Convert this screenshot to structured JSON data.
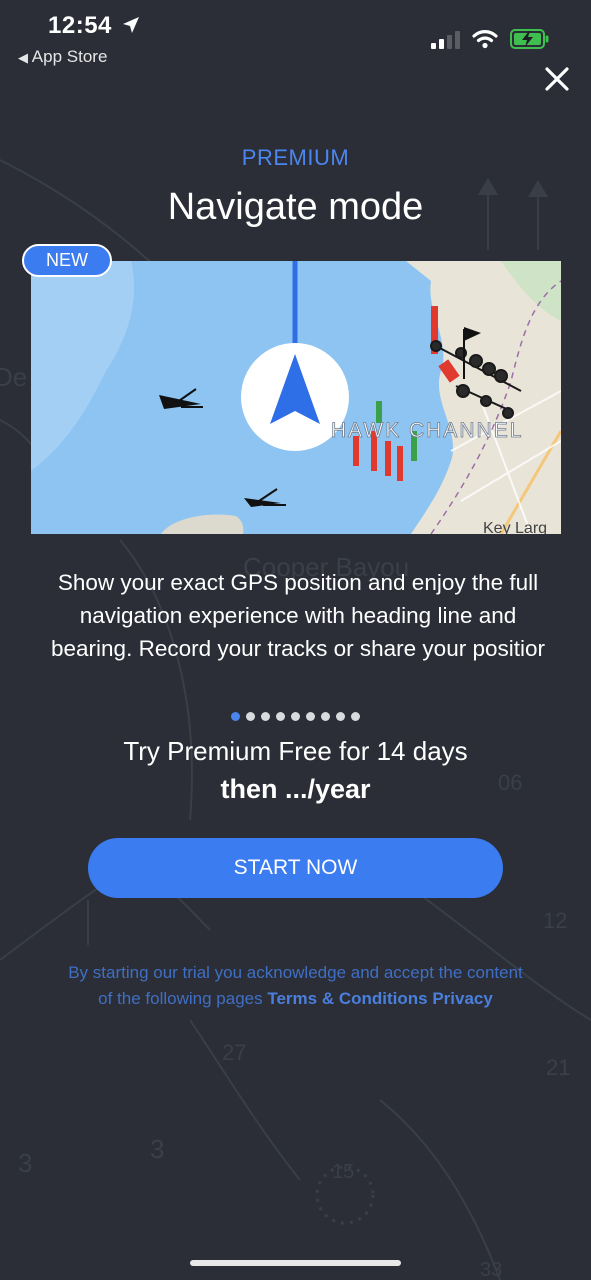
{
  "status_bar": {
    "time": "12:54",
    "back_label": "App Store"
  },
  "header": {
    "eyebrow": "PREMIUM",
    "title": "Navigate mode"
  },
  "feature_card": {
    "badge": "NEW",
    "map_channel_label": "HAWK CHANNEL",
    "map_place_label": "Key Larg"
  },
  "background_map_labels": [
    "Cooper Bayou",
    "De",
    "06",
    "12",
    "27",
    "21",
    "3",
    "3",
    "15",
    "33"
  ],
  "description": {
    "line1": "Show your exact GPS position and enjoy the full",
    "line2": "navigation experience with heading line and",
    "line3": "bearing. Record your tracks or share your positior"
  },
  "pager": {
    "count": 9,
    "active_index": 0
  },
  "offer": {
    "trial_text": "Try Premium Free for 14 days",
    "price_text": "then .../year"
  },
  "cta": {
    "label": "START NOW"
  },
  "legal": {
    "line1": "By starting our trial you acknowledge and accept the content",
    "line2_prefix": "of the following pages",
    "terms_link": "Terms & Conditions",
    "privacy_link": "Privacy"
  },
  "colors": {
    "accent": "#3b7cf0",
    "background": "#2b2e36",
    "map_water": "#8dc4f2",
    "marker_red": "#e03a2f",
    "marker_green": "#3aa04a"
  },
  "icons": [
    "location-arrow-icon",
    "cellular-signal-icon",
    "wifi-icon",
    "battery-charging-icon",
    "close-icon",
    "navigation-arrow-icon"
  ]
}
